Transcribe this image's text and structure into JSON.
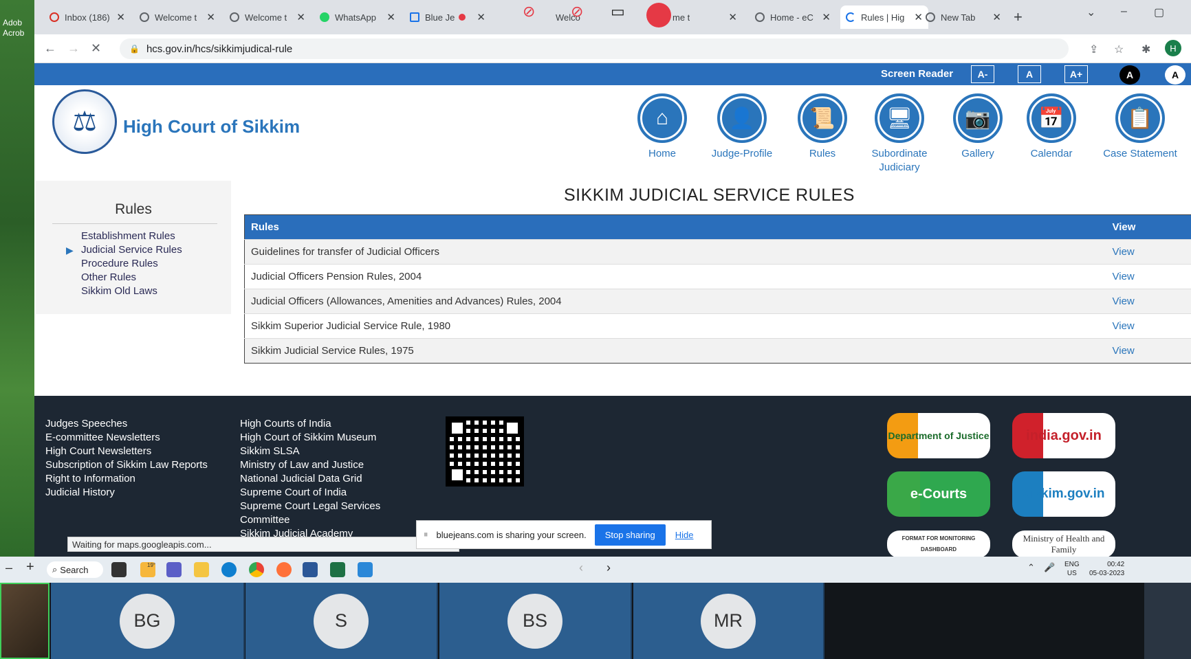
{
  "desktop": {
    "icon_label": "Adob Acrob"
  },
  "browser": {
    "tabs": [
      {
        "label": "Inbox (186)"
      },
      {
        "label": "Welcome t"
      },
      {
        "label": "Welcome t"
      },
      {
        "label": "WhatsApp"
      },
      {
        "label": "Blue Je"
      },
      {
        "label": "Welco"
      },
      {
        "label": "me t"
      },
      {
        "label": "Home - eC"
      },
      {
        "label": "Rules | Hig"
      },
      {
        "label": "New Tab"
      }
    ],
    "url": "hcs.gov.in/hcs/sikkimjudical-rule",
    "profile_initial": "H",
    "status_text": "Waiting for maps.googleapis.com..."
  },
  "site": {
    "accessibility": {
      "screen_reader": "Screen Reader",
      "font_minus": "A-",
      "font_normal": "A",
      "font_plus": "A+",
      "contrast_dark": "A",
      "contrast_light": "A"
    },
    "title": "High Court of Sikkim",
    "nav": [
      {
        "label": "Home",
        "icon": "home-icon"
      },
      {
        "label": "Judge-Profile",
        "icon": "judge-profile-icon"
      },
      {
        "label": "Rules",
        "icon": "rules-icon"
      },
      {
        "label": "Subordinate Judiciary",
        "icon": "subordinate-judiciary-icon"
      },
      {
        "label": "Gallery",
        "icon": "camera-icon"
      },
      {
        "label": "Calendar",
        "icon": "calendar-icon"
      },
      {
        "label": "Case Statement",
        "icon": "case-statement-icon"
      }
    ],
    "sidebar": {
      "title": "Rules",
      "items": [
        {
          "label": "Establishment Rules"
        },
        {
          "label": "Judicial Service Rules"
        },
        {
          "label": "Procedure Rules"
        },
        {
          "label": "Other Rules"
        },
        {
          "label": "Sikkim Old Laws"
        }
      ]
    },
    "page_heading": "SIKKIM JUDICIAL SERVICE RULES",
    "table": {
      "col_rules": "Rules",
      "col_view": "View",
      "rows": [
        {
          "rule": "Guidelines for transfer of Judicial Officers",
          "view": "View"
        },
        {
          "rule": "Judicial Officers Pension Rules, 2004",
          "view": "View"
        },
        {
          "rule": "Judicial Officers (Allowances, Amenities and Advances) Rules, 2004",
          "view": "View"
        },
        {
          "rule": "Sikkim Superior Judicial Service Rule, 1980",
          "view": "View"
        },
        {
          "rule": "Sikkim Judicial Service Rules, 1975",
          "view": "View"
        }
      ]
    },
    "footer": {
      "col1": [
        "Judges Speeches",
        "E-committee Newsletters",
        "High Court Newsletters",
        "Subscription of Sikkim Law Reports",
        "Right to Information",
        "Judicial History"
      ],
      "col2": [
        "High Courts of India",
        "High Court of Sikkim Museum",
        "Sikkim SLSA",
        "Ministry of Law and Justice",
        "National Judicial Data Grid",
        "Supreme Court of India",
        "Supreme Court Legal Services",
        "Committee",
        "Sikkim Judicial Academy"
      ],
      "badges": {
        "doj": "Department of Justice",
        "india": "india.gov.in",
        "ecourts": "e-Courts",
        "sikkim": "sikkim.gov.in",
        "small1": "FORMAT FOR MONITORING DASHBOARD",
        "small2": "Ministry of Health and Family"
      }
    }
  },
  "share_bar": {
    "message": "bluejeans.com is sharing your screen.",
    "stop": "Stop sharing",
    "hide": "Hide"
  },
  "taskbar": {
    "search": "Search",
    "lang_top": "ENG",
    "lang_bottom": "US",
    "time": "00:42",
    "date": "05-03-2023",
    "weather": "19°"
  },
  "participants": [
    "BG",
    "S",
    "BS",
    "MR"
  ]
}
